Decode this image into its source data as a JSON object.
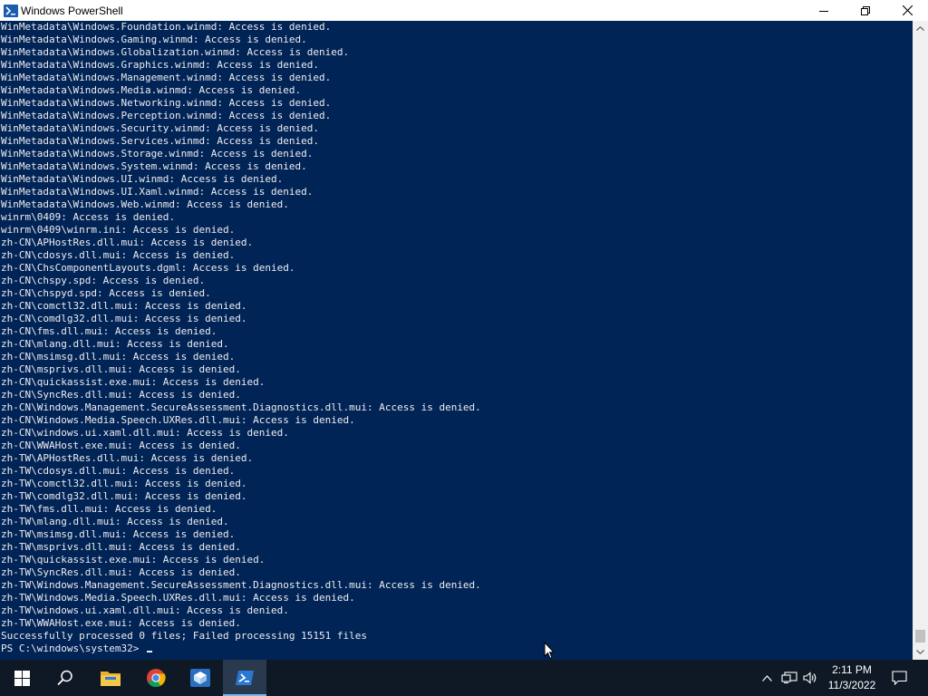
{
  "window": {
    "title": "Windows PowerShell"
  },
  "console": {
    "lines": [
      "WinMetadata\\Windows.Foundation.winmd: Access is denied.",
      "WinMetadata\\Windows.Gaming.winmd: Access is denied.",
      "WinMetadata\\Windows.Globalization.winmd: Access is denied.",
      "WinMetadata\\Windows.Graphics.winmd: Access is denied.",
      "WinMetadata\\Windows.Management.winmd: Access is denied.",
      "WinMetadata\\Windows.Media.winmd: Access is denied.",
      "WinMetadata\\Windows.Networking.winmd: Access is denied.",
      "WinMetadata\\Windows.Perception.winmd: Access is denied.",
      "WinMetadata\\Windows.Security.winmd: Access is denied.",
      "WinMetadata\\Windows.Services.winmd: Access is denied.",
      "WinMetadata\\Windows.Storage.winmd: Access is denied.",
      "WinMetadata\\Windows.System.winmd: Access is denied.",
      "WinMetadata\\Windows.UI.winmd: Access is denied.",
      "WinMetadata\\Windows.UI.Xaml.winmd: Access is denied.",
      "WinMetadata\\Windows.Web.winmd: Access is denied.",
      "winrm\\0409: Access is denied.",
      "winrm\\0409\\winrm.ini: Access is denied.",
      "zh-CN\\APHostRes.dll.mui: Access is denied.",
      "zh-CN\\cdosys.dll.mui: Access is denied.",
      "zh-CN\\ChsComponentLayouts.dgml: Access is denied.",
      "zh-CN\\chspy.spd: Access is denied.",
      "zh-CN\\chspyd.spd: Access is denied.",
      "zh-CN\\comctl32.dll.mui: Access is denied.",
      "zh-CN\\comdlg32.dll.mui: Access is denied.",
      "zh-CN\\fms.dll.mui: Access is denied.",
      "zh-CN\\mlang.dll.mui: Access is denied.",
      "zh-CN\\msimsg.dll.mui: Access is denied.",
      "zh-CN\\msprivs.dll.mui: Access is denied.",
      "zh-CN\\quickassist.exe.mui: Access is denied.",
      "zh-CN\\SyncRes.dll.mui: Access is denied.",
      "zh-CN\\Windows.Management.SecureAssessment.Diagnostics.dll.mui: Access is denied.",
      "zh-CN\\Windows.Media.Speech.UXRes.dll.mui: Access is denied.",
      "zh-CN\\windows.ui.xaml.dll.mui: Access is denied.",
      "zh-CN\\WWAHost.exe.mui: Access is denied.",
      "zh-TW\\APHostRes.dll.mui: Access is denied.",
      "zh-TW\\cdosys.dll.mui: Access is denied.",
      "zh-TW\\comctl32.dll.mui: Access is denied.",
      "zh-TW\\comdlg32.dll.mui: Access is denied.",
      "zh-TW\\fms.dll.mui: Access is denied.",
      "zh-TW\\mlang.dll.mui: Access is denied.",
      "zh-TW\\msimsg.dll.mui: Access is denied.",
      "zh-TW\\msprivs.dll.mui: Access is denied.",
      "zh-TW\\quickassist.exe.mui: Access is denied.",
      "zh-TW\\SyncRes.dll.mui: Access is denied.",
      "zh-TW\\Windows.Management.SecureAssessment.Diagnostics.dll.mui: Access is denied.",
      "zh-TW\\Windows.Media.Speech.UXRes.dll.mui: Access is denied.",
      "zh-TW\\windows.ui.xaml.dll.mui: Access is denied.",
      "zh-TW\\WWAHost.exe.mui: Access is denied.",
      "Successfully processed 0 files; Failed processing 15151 files"
    ],
    "prompt": "PS C:\\windows\\system32> "
  },
  "taskbar": {
    "icons": [
      "windows-start-icon",
      "search-icon",
      "file-explorer-icon",
      "chrome-icon",
      "virtualbox-icon",
      "powershell-icon"
    ],
    "active_app": "powershell-icon"
  },
  "tray": {
    "icons": [
      "chevron-up-icon",
      "network-icon",
      "volume-icon",
      "notification-icon"
    ],
    "time": "2:11 PM",
    "date": "11/3/2022"
  },
  "colors": {
    "console_bg": "#012456",
    "console_fg": "#eeedf0",
    "taskbar_bg": "#0f1925",
    "active_underline": "#76b9ed"
  }
}
